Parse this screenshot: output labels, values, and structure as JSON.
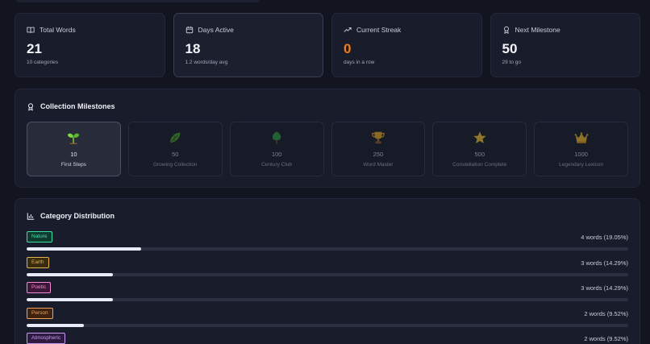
{
  "stats": [
    {
      "label": "Total Words",
      "value": "21",
      "sub": "10 categories",
      "icon": "book-icon"
    },
    {
      "label": "Days Active",
      "value": "18",
      "sub": "1.2 words/day avg",
      "icon": "calendar-icon"
    },
    {
      "label": "Current Streak",
      "value": "0",
      "sub": "days in a row",
      "icon": "trending-up-icon",
      "value_color": "#f07a1e"
    },
    {
      "label": "Next Milestone",
      "value": "50",
      "sub": "29 to go",
      "icon": "award-icon"
    }
  ],
  "milestones": {
    "title": "Collection Milestones",
    "items": [
      {
        "target": "10",
        "name": "First Steps",
        "icon": "sprout-icon",
        "achieved": true
      },
      {
        "target": "50",
        "name": "Growing Collection",
        "icon": "leaf-icon",
        "achieved": false
      },
      {
        "target": "100",
        "name": "Century Club",
        "icon": "tree-icon",
        "achieved": false
      },
      {
        "target": "250",
        "name": "Word Master",
        "icon": "trophy-icon",
        "achieved": false
      },
      {
        "target": "500",
        "name": "Constellation Complete",
        "icon": "star-icon",
        "achieved": false
      },
      {
        "target": "1000",
        "name": "Legendary Lexicon",
        "icon": "crown-icon",
        "achieved": false
      }
    ]
  },
  "distribution": {
    "title": "Category Distribution",
    "rows": [
      {
        "tag": "Nature",
        "count": "4 words (19.05%)",
        "share": 19.05,
        "color": "#3fe0a8",
        "bg": "#0f3a2e"
      },
      {
        "tag": "Earth",
        "count": "3 words (14.29%)",
        "share": 14.29,
        "color": "#e0b24a",
        "bg": "#3a2c10"
      },
      {
        "tag": "Poetic",
        "count": "3 words (14.29%)",
        "share": 14.29,
        "color": "#f08ad6",
        "bg": "#3e1638"
      },
      {
        "tag": "Person",
        "count": "2 words (9.52%)",
        "share": 9.52,
        "color": "#f0a05a",
        "bg": "#3e2410"
      },
      {
        "tag": "Atmospheric",
        "count": "2 words (9.52%)",
        "share": 9.52,
        "color": "#c89af0",
        "bg": "#2e1a40"
      }
    ]
  }
}
